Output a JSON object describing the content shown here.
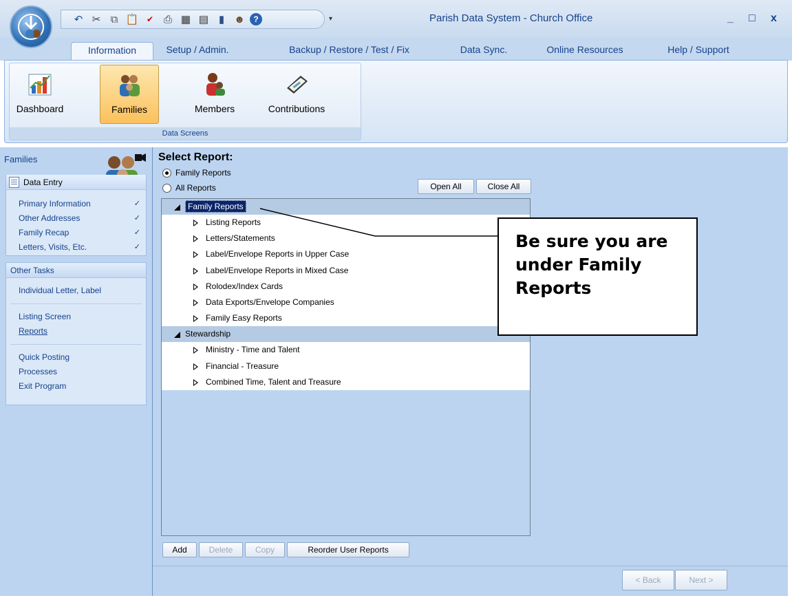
{
  "window": {
    "title": "Parish Data System - Church Office",
    "minimize": "_",
    "maximize": "□",
    "close": "x"
  },
  "qat_icons": [
    "undo-icon",
    "cut-icon",
    "copy-icon",
    "paste-icon",
    "spellcheck-icon",
    "print-icon",
    "calculator-icon",
    "calendar-icon",
    "book-icon",
    "people-icon",
    "help-icon"
  ],
  "tabs": [
    {
      "label": "Information",
      "active": true
    },
    {
      "label": "Setup / Admin."
    },
    {
      "label": "Backup / Restore / Test / Fix"
    },
    {
      "label": "Data Sync."
    },
    {
      "label": "Online Resources"
    },
    {
      "label": "Help / Support"
    }
  ],
  "ribbon": {
    "group_label": "Data Screens",
    "buttons": [
      {
        "label": "Dashboard",
        "icon": "dashboard-icon"
      },
      {
        "label": "Families",
        "icon": "families-icon",
        "active": true
      },
      {
        "label": "Members",
        "icon": "members-icon"
      },
      {
        "label": "Contributions",
        "icon": "contributions-icon"
      }
    ]
  },
  "leftpane": {
    "header": "Families",
    "data_entry": {
      "title": "Data Entry",
      "items": [
        {
          "label": "Primary Information",
          "check": "✓"
        },
        {
          "label": "Other Addresses",
          "check": "✓"
        },
        {
          "label": "Family Recap",
          "check": "✓"
        },
        {
          "label": "Letters, Visits, Etc.",
          "check": "✓"
        }
      ]
    },
    "other_tasks": {
      "title": "Other Tasks",
      "items": [
        "Individual Letter, Label",
        "Listing Screen",
        "Reports",
        "Quick Posting",
        "Processes",
        "Exit Program"
      ]
    }
  },
  "main": {
    "select_title": "Select Report:",
    "radio_family": "Family Reports",
    "radio_all": "All Reports",
    "open_all": "Open All",
    "close_all": "Close All",
    "tree": [
      {
        "label": "Family Reports",
        "selected": true,
        "children": [
          "Listing Reports",
          "Letters/Statements",
          "Label/Envelope Reports in Upper Case",
          "Label/Envelope Reports in Mixed Case",
          "Rolodex/Index Cards",
          "Data Exports/Envelope Companies",
          "Family Easy Reports"
        ]
      },
      {
        "label": "Stewardship",
        "children": [
          "Ministry - Time and Talent",
          "Financial - Treasure",
          "Combined Time, Talent and Treasure"
        ]
      }
    ],
    "add": "Add",
    "delete": "Delete",
    "copy": "Copy",
    "reorder": "Reorder User Reports",
    "back": "< Back",
    "next": "Next >"
  },
  "callout": {
    "line1": "Be sure you are",
    "line2": "under Family",
    "line3": "Reports"
  }
}
